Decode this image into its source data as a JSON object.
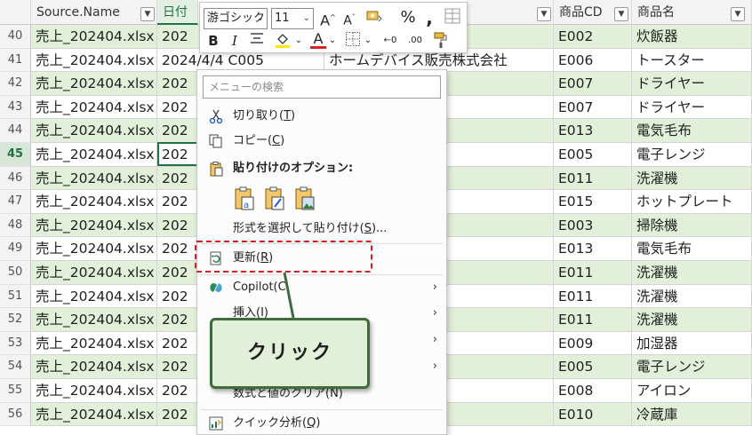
{
  "columns": {
    "a": "Source.Name",
    "b": "日付",
    "d": "商品CD",
    "e": "商品名"
  },
  "rows": [
    {
      "num": "40",
      "a": "売上_202404.xlsx",
      "b": "202",
      "c": "ン株式会社",
      "d": "E002",
      "e": "炊飯器"
    },
    {
      "num": "41",
      "a": "売上_202404.xlsx",
      "b": "2024/4/4 C005",
      "c": "ホームデバイス販売株式会社",
      "d": "E006",
      "e": "トースター"
    },
    {
      "num": "42",
      "a": "売上_202404.xlsx",
      "b": "202",
      "c": "電器",
      "d": "E007",
      "e": "ドライヤー"
    },
    {
      "num": "43",
      "a": "売上_202404.xlsx",
      "b": "202",
      "c": "電器",
      "d": "E007",
      "e": "ドライヤー"
    },
    {
      "num": "44",
      "a": "売上_202404.xlsx",
      "b": "202",
      "c": "売株式会社",
      "d": "E013",
      "e": "電気毛布"
    },
    {
      "num": "45",
      "a": "売上_202404.xlsx",
      "b": "202",
      "c": "電器",
      "d": "E005",
      "e": "電子レンジ"
    },
    {
      "num": "46",
      "a": "売上_202404.xlsx",
      "b": "202",
      "c": "式会社",
      "d": "E011",
      "e": "洗濯機"
    },
    {
      "num": "47",
      "a": "売上_202404.xlsx",
      "b": "202",
      "c": "売株式会社",
      "d": "E015",
      "e": "ホットプレート"
    },
    {
      "num": "48",
      "a": "売上_202404.xlsx",
      "b": "202",
      "c": "ック",
      "d": "E003",
      "e": "掃除機"
    },
    {
      "num": "49",
      "a": "売上_202404.xlsx",
      "b": "202",
      "c": "ング株式会社",
      "d": "E013",
      "e": "電気毛布"
    },
    {
      "num": "50",
      "a": "売上_202404.xlsx",
      "b": "202",
      "c": "ック",
      "d": "E011",
      "e": "洗濯機"
    },
    {
      "num": "51",
      "a": "売上_202404.xlsx",
      "b": "202",
      "c": "ック",
      "d": "E011",
      "e": "洗濯機"
    },
    {
      "num": "52",
      "a": "売上_202404.xlsx",
      "b": "202",
      "c": "ック",
      "d": "E011",
      "e": "洗濯機"
    },
    {
      "num": "53",
      "a": "売上_202404.xlsx",
      "b": "202",
      "c": "ック",
      "d": "E009",
      "e": "加湿器"
    },
    {
      "num": "54",
      "a": "売上_202404.xlsx",
      "b": "202",
      "c": "ング株式会社",
      "d": "E005",
      "e": "電子レンジ"
    },
    {
      "num": "55",
      "a": "売上_202404.xlsx",
      "b": "202",
      "c": "電器",
      "d": "E008",
      "e": "アイロン"
    },
    {
      "num": "56",
      "a": "売上_202404.xlsx",
      "b": "202",
      "c": "ング株式会社",
      "d": "E010",
      "e": "冷蔵庫"
    }
  ],
  "toolbar": {
    "font_name": "游ゴシック",
    "font_size": "11"
  },
  "menu": {
    "search_placeholder": "メニューの検索",
    "cut": "切り取り(",
    "cut_key": "T",
    "copy": "コピー(",
    "copy_key": "C",
    "paste_options": "貼り付けのオプション:",
    "paste_special": "形式を選択して貼り付け(",
    "paste_special_key": "S",
    "paste_special_tail": ")...",
    "refresh": "更新(",
    "refresh_key": "R",
    "copilot": "Copilot(C",
    "insert": "挿入(I)",
    "clear": "数式と値のクリア(N)",
    "quick_analysis": "クイック分析(",
    "quick_analysis_key": "Q",
    "close_paren": ")"
  },
  "callout": {
    "text": "クリック"
  },
  "colors": {
    "alt_row": "#e2f0d9",
    "excel_green": "#217346",
    "highlight_red": "#d81b1b"
  }
}
